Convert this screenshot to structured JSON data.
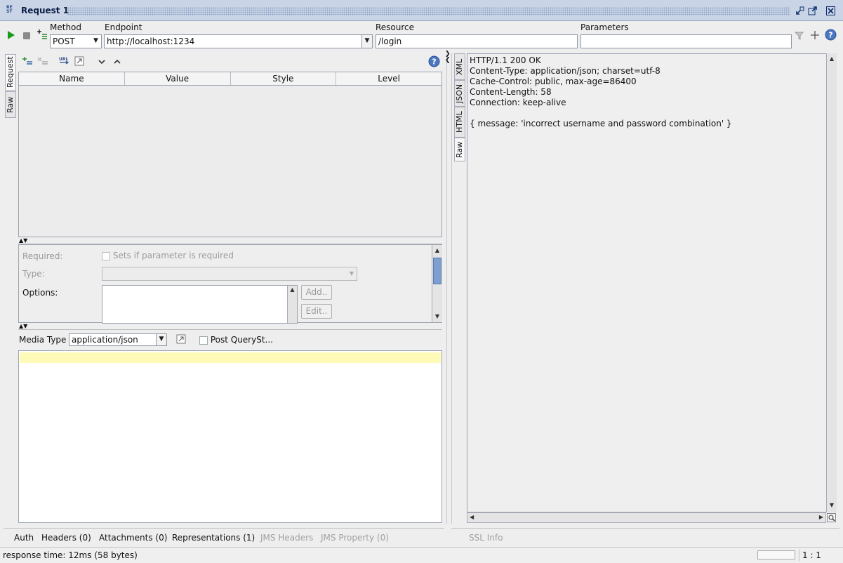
{
  "window": {
    "title": "Request 1",
    "logo_text": "RE ST"
  },
  "toolbar": {
    "method_label": "Method",
    "method_value": "POST",
    "endpoint_label": "Endpoint",
    "endpoint_value": "http://localhost:1234",
    "resource_label": "Resource",
    "resource_value": "/login",
    "parameters_label": "Parameters",
    "parameters_value": ""
  },
  "left_tabs": [
    "Request",
    "Raw"
  ],
  "param_table": {
    "columns": [
      "Name",
      "Value",
      "Style",
      "Level"
    ],
    "rows": []
  },
  "detail": {
    "required_label": "Required:",
    "required_checkbox": "Sets if parameter is required",
    "type_label": "Type:",
    "type_value": "",
    "options_label": "Options:",
    "add_button": "Add..",
    "edit_button": "Edit.."
  },
  "media": {
    "label": "Media Type",
    "value": "application/json",
    "post_query_label": "Post QuerySt..."
  },
  "response_tabs": [
    "XML",
    "JSON",
    "HTML",
    "Raw"
  ],
  "response_text": "HTTP/1.1 200 OK\nContent-Type: application/json; charset=utf-8\nCache-Control: public, max-age=86400\nContent-Length: 58\nConnection: keep-alive\n\n{ message: 'incorrect username and password combination' }",
  "bottom_tabs_left": [
    {
      "label": "Auth",
      "enabled": true
    },
    {
      "label": "Headers (0)",
      "enabled": true
    },
    {
      "label": "Attachments (0)",
      "enabled": true
    },
    {
      "label": "Representations (1)",
      "enabled": true
    },
    {
      "label": "JMS Headers",
      "enabled": false
    },
    {
      "label": "JMS Property (0)",
      "enabled": false
    }
  ],
  "bottom_tabs_right": [
    {
      "label": "SSL Info",
      "enabled": false
    }
  ],
  "status": {
    "response_time": "response time: 12ms (58 bytes)",
    "position": "1 : 1"
  },
  "colors": {
    "title_bar": "#c9d4e6",
    "editor_highlight": "#fdfbb7",
    "run_green": "#1c9a1c"
  }
}
